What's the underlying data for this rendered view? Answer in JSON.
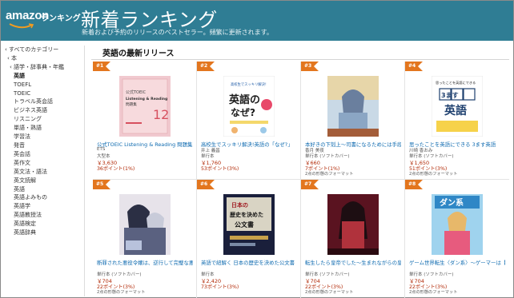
{
  "header": {
    "logo_word": "amazon",
    "logo_rank": "ランキング",
    "title": "新着ランキング",
    "subtitle": "新着および予約のリリースのベストセラー。頻繁に更新されます。"
  },
  "sidebar": {
    "items": [
      {
        "label": "‹ すべてのカテゴリー",
        "level": 0
      },
      {
        "label": "‹ 本",
        "level": 1
      },
      {
        "label": "‹ 語学・辞事典・年鑑",
        "level": 2
      },
      {
        "label": "英語",
        "level": 3,
        "bold": true
      },
      {
        "label": "TOEFL",
        "level": 3
      },
      {
        "label": "TOEIC",
        "level": 3
      },
      {
        "label": "トラベル英会話",
        "level": 3
      },
      {
        "label": "ビジネス英語",
        "level": 3
      },
      {
        "label": "リスニング",
        "level": 3
      },
      {
        "label": "単語・熟語",
        "level": 3
      },
      {
        "label": "学習法",
        "level": 3
      },
      {
        "label": "発音",
        "level": 3
      },
      {
        "label": "英会話",
        "level": 3
      },
      {
        "label": "英作文",
        "level": 3
      },
      {
        "label": "英文法・語法",
        "level": 3
      },
      {
        "label": "英文読解",
        "level": 3
      },
      {
        "label": "英語",
        "level": 3
      },
      {
        "label": "英語よみもの",
        "level": 3
      },
      {
        "label": "英語学",
        "level": 3
      },
      {
        "label": "英語教授法",
        "level": 3
      },
      {
        "label": "英語検定",
        "level": 3
      },
      {
        "label": "英語辞典",
        "level": 3
      }
    ]
  },
  "section": {
    "title": "英語の最新リリース"
  },
  "products": [
    {
      "rank": "#1",
      "title": "公式TOEIC Listening & Reading 問題集 12",
      "title2": "",
      "author": "ETS",
      "author2": "大型本",
      "price": "￥3,630",
      "points": "36ポイント(1%)",
      "format": ""
    },
    {
      "rank": "#2",
      "title": "高校生でスッキリ解決!英語の「なぜ?」",
      "title2": "",
      "author": "井上 義昌",
      "author2": "単行本",
      "price": "￥1,760",
      "points": "53ポイント(3%)",
      "format": ""
    },
    {
      "rank": "#3",
      "title": "本好きの下剋上～司書になるためには手段を...",
      "title2": "",
      "author": "香月 美夜",
      "author2": "単行本 (ソフトカバー)",
      "price": "￥660",
      "points": "7ポイント(1%)",
      "format": "2点の形態のフォーマット"
    },
    {
      "rank": "#4",
      "title": "思ったことを英語にできる 3ます英語",
      "title2": "",
      "author": "川崎 香おみ",
      "author2": "単行本 (ソフトカバー)",
      "price": "￥1,650",
      "points": "51ポイント(3%)",
      "format": "2点の形態のフォーマット"
    },
    {
      "rank": "#5",
      "title": "断罪された悪役令嬢は、逆行して完璧な悪女...",
      "title2": "",
      "author": "",
      "author2": "単行本 (ソフトカバー)",
      "price": "￥704",
      "points": "22ポイント(3%)",
      "format": "2点の形態のフォーマット"
    },
    {
      "rank": "#6",
      "title": "英語で紐解く 日本の歴史を決めた公文書",
      "title2": "",
      "author": "",
      "author2": "単行本",
      "price": "￥2,420",
      "points": "73ポイント(3%)",
      "format": ""
    },
    {
      "rank": "#7",
      "title": "転生したら皇帝でした～生まれながらの皇帝...",
      "title2": "",
      "author": "",
      "author2": "単行本 (ソフトカバー)",
      "price": "￥704",
      "points": "22ポイント(3%)",
      "format": "2点の形態のフォーマット"
    },
    {
      "rank": "#8",
      "title": "ゲーム世界転生〈ダン系〉～ゲーマーは【ゲ...",
      "title2": "",
      "author": "",
      "author2": "単行本 (ソフトカバー)",
      "price": "￥704",
      "points": "22ポイント(3%)",
      "format": "2点の形態のフォーマット"
    }
  ],
  "covers": {
    "c1": {
      "line1": "公式TOEIC",
      "line2": "Listening & Reading",
      "line3": "問題集",
      "num": "12"
    },
    "c2": {
      "top": "高校生でスッキリ解決!",
      "main": "英語の",
      "main2": "なぜ?"
    },
    "c4": {
      "top": "思ったことを英語にできる",
      "main": "3ます",
      "main2": "英語"
    },
    "c6": {
      "main": "日本の",
      "main2": "歴史を決めた",
      "main3": "公文書"
    },
    "c8": {
      "main": "ダン系"
    }
  },
  "colors": {
    "header_bg": "#2f7d94",
    "badge": "#e3761e",
    "link": "#0f6bb0",
    "price": "#b12704"
  }
}
